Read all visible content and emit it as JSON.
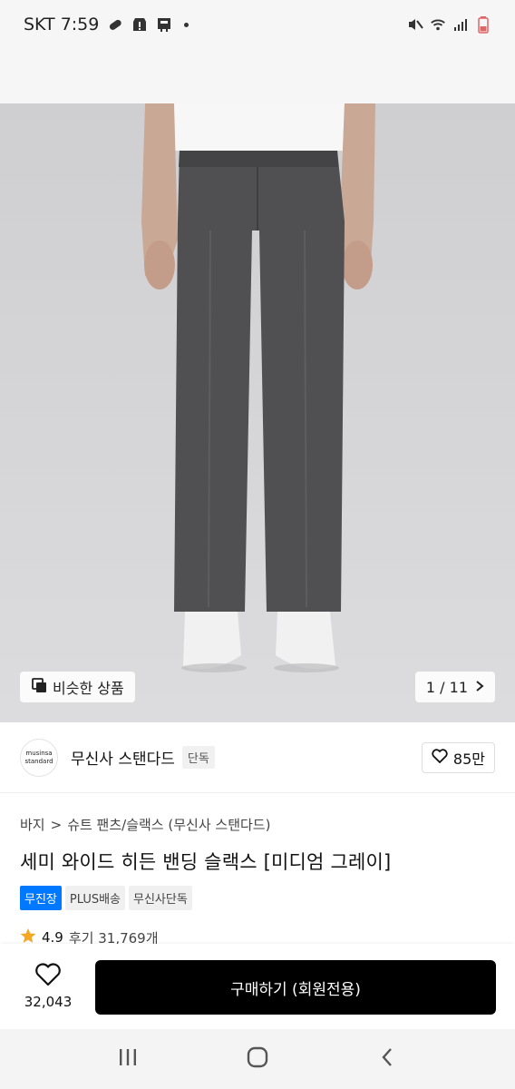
{
  "status_bar": {
    "carrier_time": "SKT 7:59",
    "icons": [
      "pill-icon",
      "alert-icon",
      "app-icon",
      "dot-icon",
      "mute-icon",
      "wifi-icon",
      "signal-icon",
      "battery-icon"
    ]
  },
  "hero": {
    "similar_label": "비슷한 상품",
    "pager": "1 / 11"
  },
  "brand": {
    "logo_line1": "musinsa",
    "logo_line2": "standard",
    "name": "무신사 스탠다드",
    "badge": "단독",
    "likes": "85만"
  },
  "breadcrumb": {
    "root": "바지",
    "separator": ">",
    "category": "슈트 팬츠/슬랙스 (무신사 스탠다드)"
  },
  "product": {
    "title": "세미 와이드 히든 밴딩 슬랙스 [미디엄 그레이]",
    "tags": [
      "무진장",
      "PLUS배송",
      "무신사단독"
    ]
  },
  "rating": {
    "score": "4.9",
    "reviews": "후기 31,769개"
  },
  "buy_bar": {
    "wish_count": "32,043",
    "buy_label": "구매하기 (회원전용)"
  },
  "colors": {
    "accent_blue": "#0078ff",
    "buy_button": "#000000",
    "star": "#f5a623"
  }
}
